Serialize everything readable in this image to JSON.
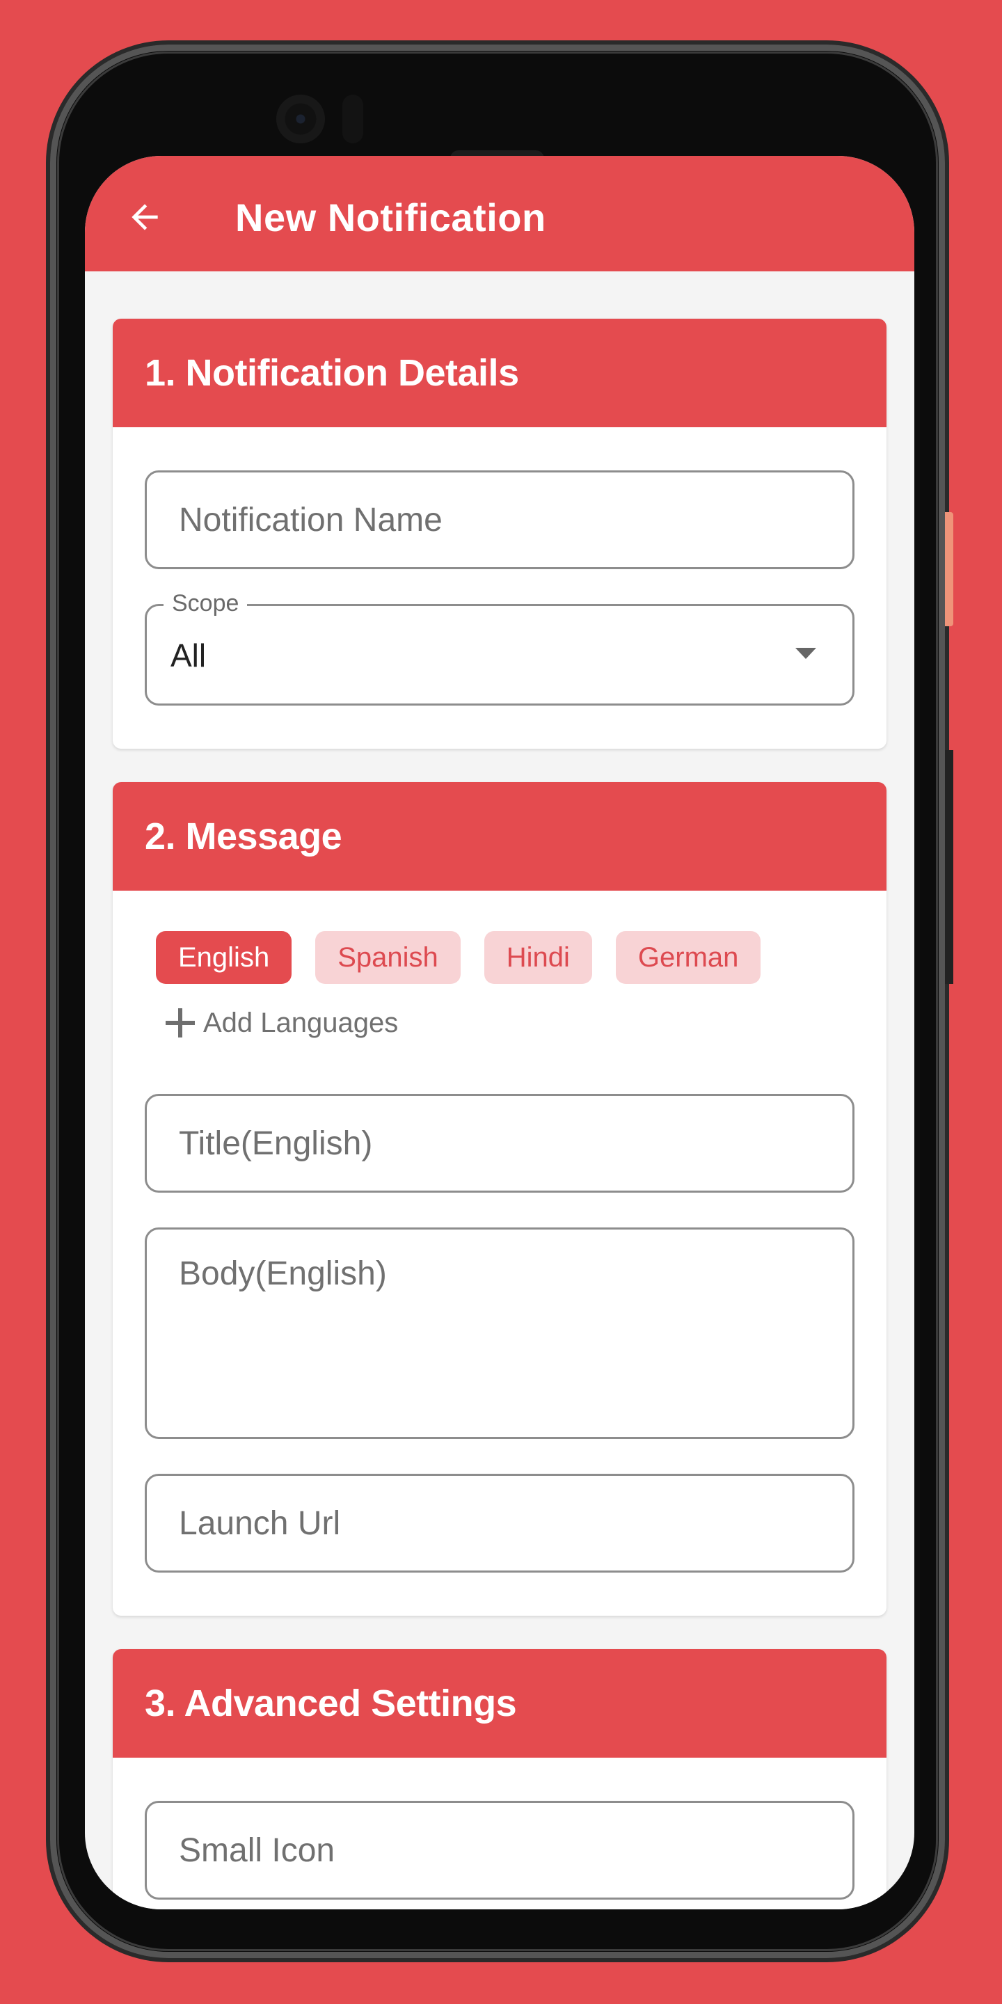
{
  "app": {
    "title": "New Notification",
    "back_icon": "arrow-left-icon",
    "accent_color": "#e44b4f",
    "chip_inactive_bg": "#f8d3d5"
  },
  "sections": {
    "details": {
      "title": "1. Notification Details",
      "name_placeholder": "Notification Name",
      "scope": {
        "label": "Scope",
        "value": "All",
        "icon": "caret-down-icon"
      }
    },
    "message": {
      "title": "2. Message",
      "languages": [
        {
          "label": "English",
          "selected": true
        },
        {
          "label": "Spanish",
          "selected": false
        },
        {
          "label": "Hindi",
          "selected": false
        },
        {
          "label": "German",
          "selected": false
        }
      ],
      "add_languages_label": "Add Languages",
      "title_placeholder": "Title(English)",
      "body_placeholder": "Body(English)",
      "launch_url_placeholder": "Launch Url"
    },
    "advanced": {
      "title": "3. Advanced Settings",
      "small_icon_placeholder": "Small Icon"
    }
  }
}
